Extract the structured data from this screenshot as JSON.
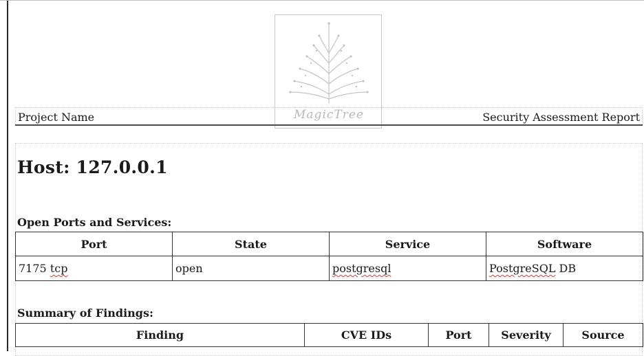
{
  "header": {
    "project_name": "Project Name",
    "report_title": "Security Assessment Report",
    "logo_text": "MagicTree"
  },
  "host": {
    "title": "Host: 127.0.0.1"
  },
  "ports_section": {
    "title": "Open Ports and Services:",
    "columns": [
      "Port",
      "State",
      "Service",
      "Software"
    ],
    "rows": [
      {
        "port_number": "7175",
        "port_proto": "tcp",
        "state": "open",
        "service": "postgresql",
        "software_a": "PostgreSQL",
        "software_b": "DB"
      }
    ]
  },
  "findings_section": {
    "title": "Summary of Findings:",
    "columns": [
      "Finding",
      "CVE IDs",
      "Port",
      "Severity",
      "Source"
    ]
  },
  "colors": {
    "spellcheck": "#d63b3b",
    "rule": "#4a4a4a"
  }
}
